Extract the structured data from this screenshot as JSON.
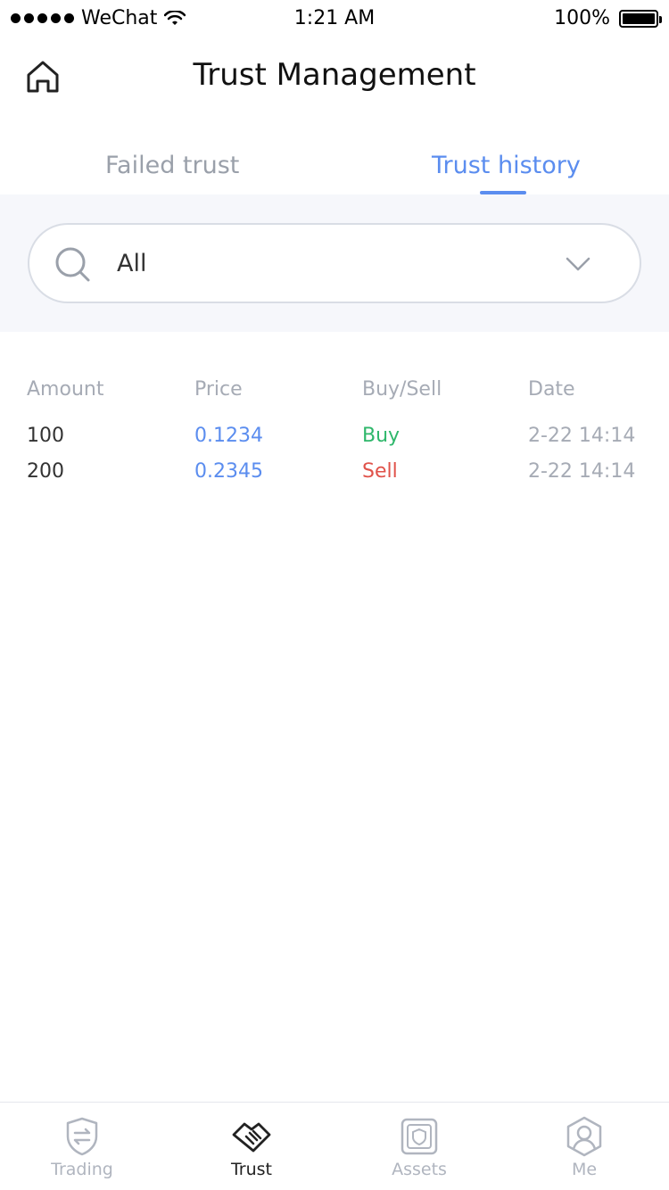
{
  "status_bar": {
    "carrier": "WeChat",
    "time": "1:21 AM",
    "battery": "100%"
  },
  "header": {
    "title": "Trust Management"
  },
  "tabs": [
    {
      "label": "Failed trust",
      "active": false
    },
    {
      "label": "Trust history",
      "active": true
    }
  ],
  "filter": {
    "selected": "All"
  },
  "table": {
    "columns": [
      "Amount",
      "Price",
      "Buy/Sell",
      "Date"
    ],
    "rows": [
      {
        "amount": "100",
        "price": "0.1234",
        "side": "Buy",
        "date": "2-22 14:14"
      },
      {
        "amount": "200",
        "price": "0.2345",
        "side": "Sell",
        "date": "2-22 14:14"
      }
    ]
  },
  "bottom_nav": [
    {
      "label": "Trading",
      "icon": "trading-shield-icon",
      "active": false
    },
    {
      "label": "Trust",
      "icon": "handshake-icon",
      "active": true
    },
    {
      "label": "Assets",
      "icon": "safe-icon",
      "active": false
    },
    {
      "label": "Me",
      "icon": "user-icon",
      "active": false
    }
  ],
  "colors": {
    "accent": "#5b8def",
    "buy": "#2fb76b",
    "sell": "#e0524a",
    "muted": "#a6abb5"
  }
}
